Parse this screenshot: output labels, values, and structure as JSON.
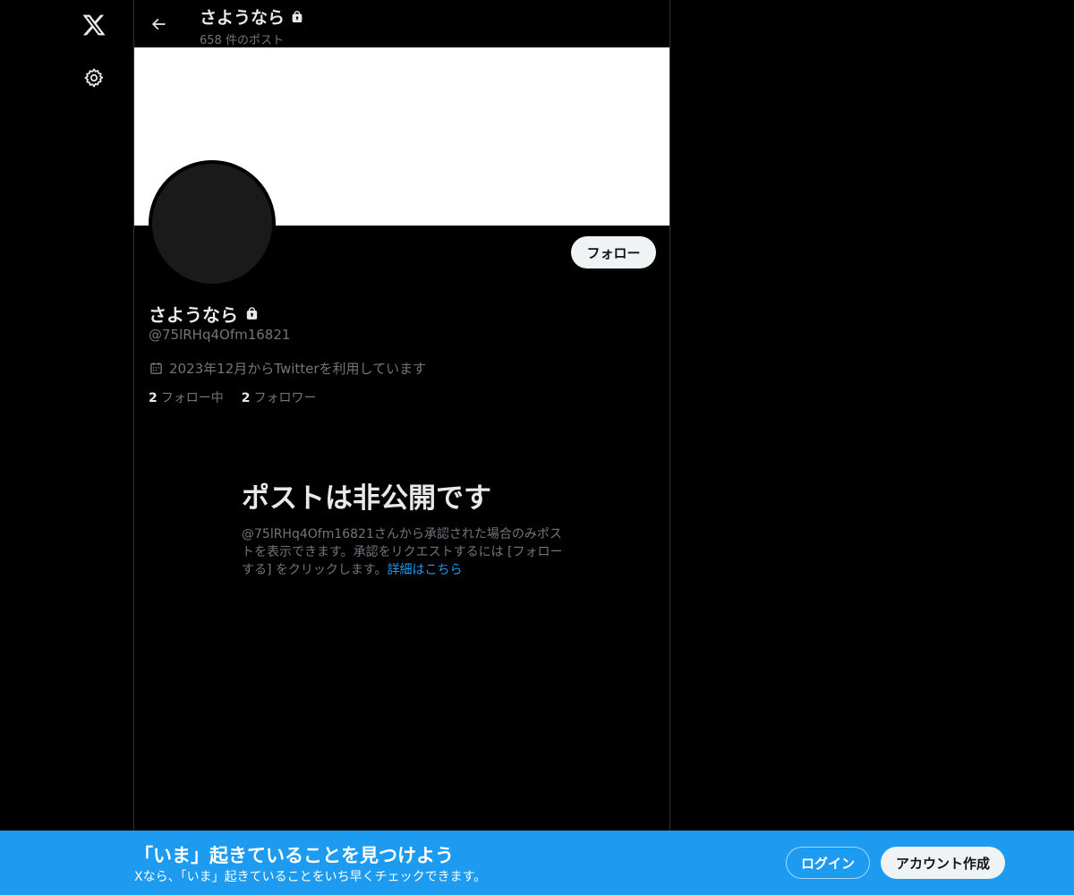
{
  "nav": {
    "logo_icon": "x-logo-icon",
    "settings_icon": "gear-icon"
  },
  "header": {
    "back_icon": "arrow-left-icon",
    "name": "さようなら",
    "lock_icon": "lock-icon",
    "post_count": "658 件のポスト"
  },
  "profile": {
    "name": "さようなら",
    "handle": "@75lRHq4Ofm16821",
    "joined_icon": "calendar-icon",
    "joined": "2023年12月からTwitterを利用しています",
    "follow_label": "フォロー",
    "following_count": "2",
    "following_label": "フォロー中",
    "followers_count": "2",
    "followers_label": "フォロワー"
  },
  "private_notice": {
    "title": "ポストは非公開です",
    "description": "@75lRHq4Ofm16821さんから承認された場合のみポストを表示できます。承認をリクエストするには [フォローする] をクリックします。",
    "link": "詳細はこちら"
  },
  "bottom_bar": {
    "title": "「いま」起きていることを見つけよう",
    "subtitle": "Xなら、「いま」起きていることをいち早くチェックできます。",
    "login_label": "ログイン",
    "signup_label": "アカウント作成"
  },
  "colors": {
    "background": "#000000",
    "accent": "#1d9bf0",
    "text_primary": "#e7e9ea",
    "text_secondary": "#71767b",
    "banner": "#ffffff"
  }
}
